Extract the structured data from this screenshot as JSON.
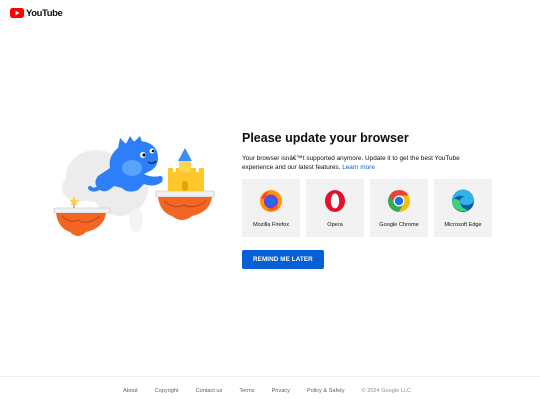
{
  "header": {
    "logo_text": "YouTube",
    "logo_icon": "youtube-play-icon",
    "brand_color": "#ff0000"
  },
  "main": {
    "title": "Please update your browser",
    "description": "Your browser isnâ€™t supported anymore. Update it to get the best YouTube experience and our latest features.",
    "learn_more": "Learn more",
    "browsers": [
      {
        "label": "Mozilla Firefox",
        "icon": "firefox-icon"
      },
      {
        "label": "Opera",
        "icon": "opera-icon"
      },
      {
        "label": "Google Chrome",
        "icon": "chrome-icon"
      },
      {
        "label": "Microsoft Edge",
        "icon": "edge-icon"
      }
    ],
    "remind_button": "REMIND ME LATER",
    "accent_color": "#065fd4"
  },
  "footer": {
    "links": [
      "About",
      "Copyright",
      "Contact us",
      "Terms",
      "Privacy",
      "Policy & Safety"
    ],
    "copyright": "© 2024 Google LLC"
  }
}
